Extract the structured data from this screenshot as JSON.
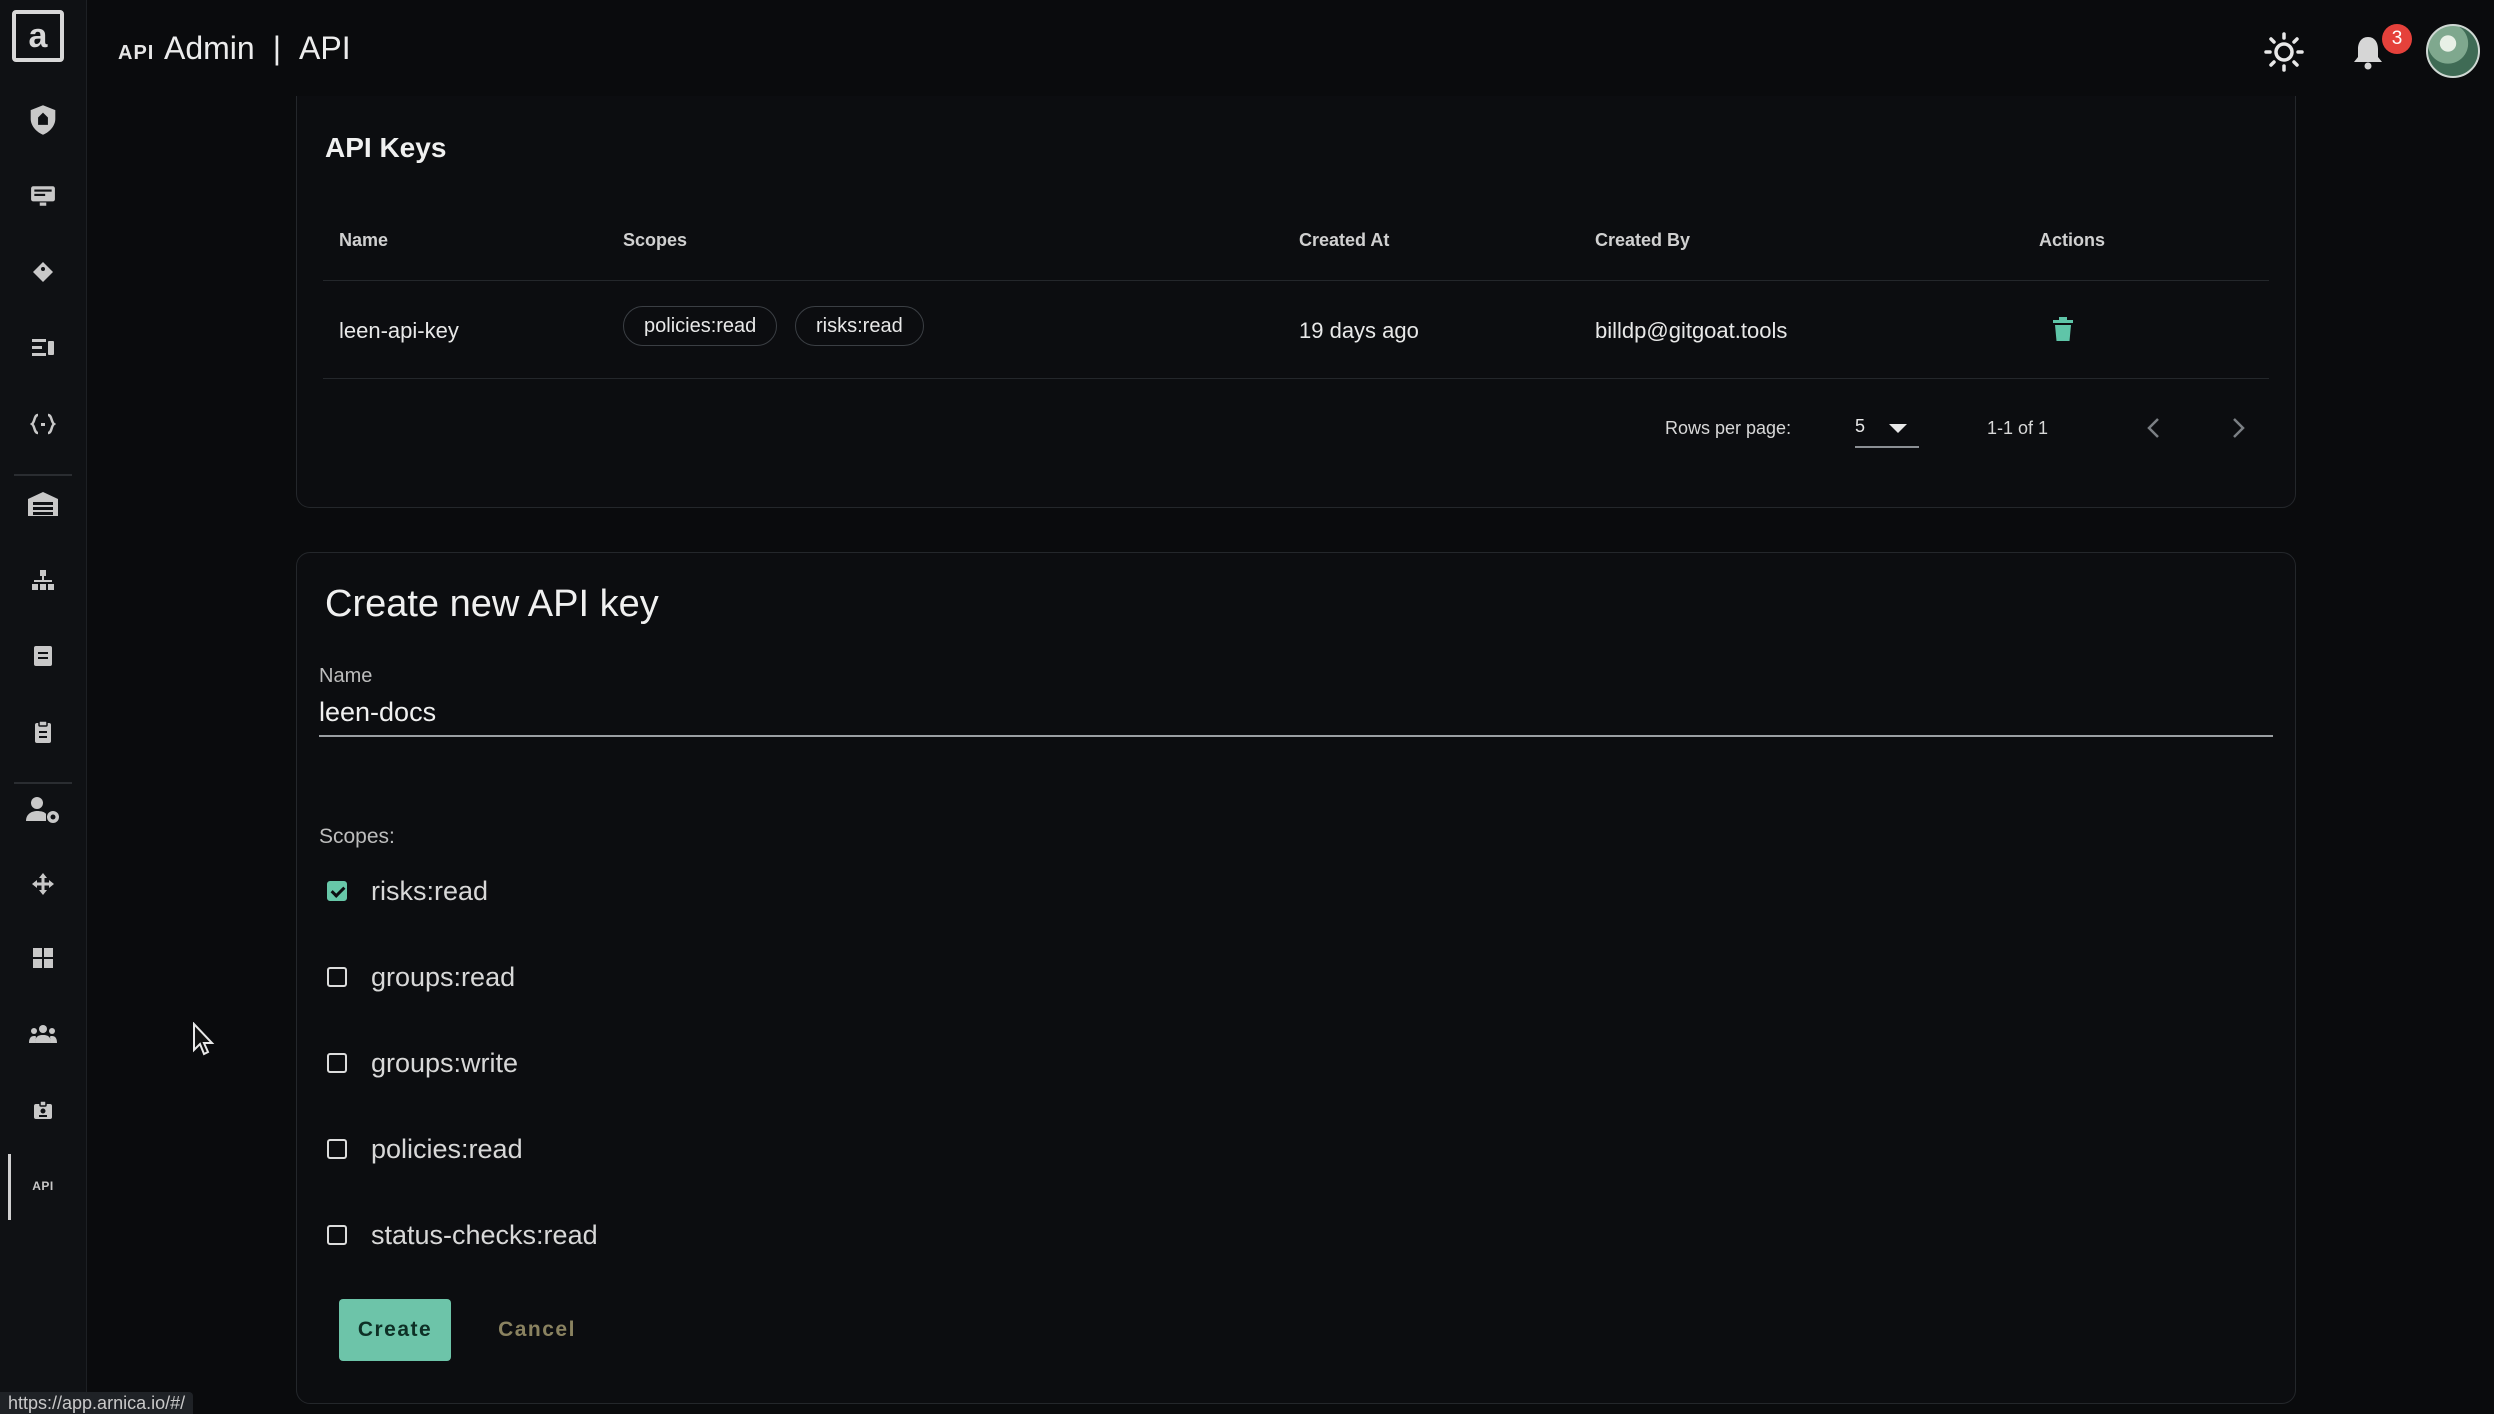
{
  "header": {
    "mini_icon": "API",
    "section": "Admin",
    "separator": "|",
    "page": "API",
    "notifications_count": "3",
    "icons": [
      "theme-toggle-icon",
      "bell-icon",
      "avatar"
    ]
  },
  "sidebar": {
    "logo": "a",
    "items": [
      {
        "icon": "shield-icon"
      },
      {
        "icon": "monitor-icon"
      },
      {
        "icon": "diamond-tag-icon"
      },
      {
        "icon": "dashboard-list-icon"
      },
      {
        "icon": "code-braces-icon"
      },
      {
        "icon": "warehouse-icon"
      },
      {
        "icon": "hierarchy-icon"
      },
      {
        "icon": "document-icon"
      },
      {
        "icon": "clipboard-icon"
      },
      {
        "icon": "user-settings-icon"
      },
      {
        "icon": "move-icon"
      },
      {
        "icon": "widgets-icon"
      },
      {
        "icon": "group-icon"
      },
      {
        "icon": "badge-icon"
      },
      {
        "icon": "api-icon",
        "label": "API",
        "active": true
      }
    ]
  },
  "api_keys": {
    "title": "API Keys",
    "columns": [
      "Name",
      "Scopes",
      "Created At",
      "Created By",
      "Actions"
    ],
    "rows": [
      {
        "name": "leen-api-key",
        "scopes": [
          "policies:read",
          "risks:read"
        ],
        "created_at": "19 days ago",
        "created_by": "billdp@gitgoat.tools",
        "actions": [
          "delete-icon"
        ]
      }
    ],
    "pagination": {
      "rows_per_page_label": "Rows per page:",
      "rows_per_page": "5",
      "range": "1-1 of 1"
    }
  },
  "create_form": {
    "title": "Create new API key",
    "name_label": "Name",
    "name_value": "leen-docs",
    "scopes_label": "Scopes:",
    "scopes": [
      {
        "label": "risks:read",
        "checked": true
      },
      {
        "label": "groups:read",
        "checked": false
      },
      {
        "label": "groups:write",
        "checked": false
      },
      {
        "label": "policies:read",
        "checked": false
      },
      {
        "label": "status-checks:read",
        "checked": false
      }
    ],
    "create_label": "Create",
    "cancel_label": "Cancel"
  },
  "status_url": "https://app.arnica.io/#/",
  "colors": {
    "accent": "#6dc4a9",
    "background": "#0a0b0d",
    "badge": "#e5413b"
  }
}
